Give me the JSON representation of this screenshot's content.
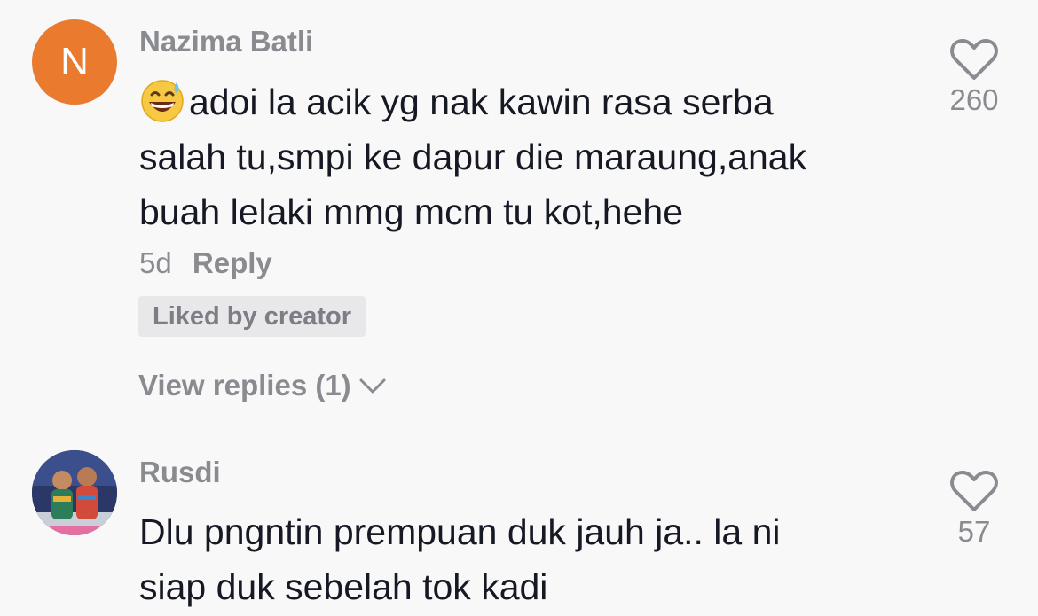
{
  "colors": {
    "background": "#f8f8f8",
    "text_primary": "#161823",
    "text_secondary": "#8a8b91",
    "avatar_orange": "#e97a2e",
    "badge_bg": "#e8e8ea"
  },
  "comments": [
    {
      "avatar_letter": "N",
      "username": "Nazima Batli",
      "emoji_icon": "grinning-face-with-sweat-icon",
      "text": "adoi la acik yg nak kawin rasa serba\nsalah tu,smpi ke dapur die maraung,anak\nbuah lelaki mmg mcm tu kot,hehe",
      "time": "5d",
      "reply_label": "Reply",
      "badge": "Liked by creator",
      "view_replies": "View replies (1)",
      "like_count": "260"
    },
    {
      "avatar_icon": "user-photo-avatar",
      "username": "Rusdi",
      "text": "Dlu pngntin prempuan duk jauh ja.. la ni\nsiap duk sebelah tok kadi",
      "like_count": "57"
    }
  ]
}
